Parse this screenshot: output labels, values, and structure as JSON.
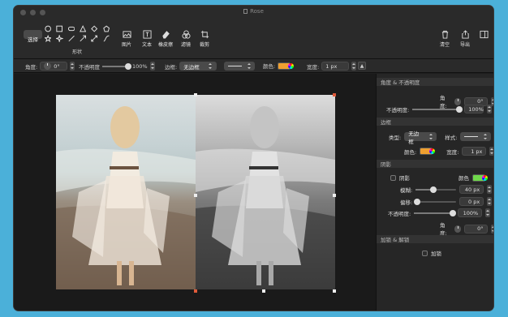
{
  "window": {
    "title": "Rose"
  },
  "toolbar": {
    "select_label": "选择",
    "shapes_label": "形状",
    "image_label": "图片",
    "text_label": "文本",
    "eraser_label": "橡皮擦",
    "filter_label": "滤镜",
    "crop_label": "裁剪",
    "clear_label": "清空",
    "export_label": "导出"
  },
  "options": {
    "angle_label": "角度:",
    "angle_value": "0°",
    "opacity_label": "不透明度",
    "opacity_value": "100%",
    "opacity_level": 1.0,
    "border_label": "边框:",
    "border_value": "无边框",
    "color_label": "颜色:",
    "color_hex": "#f0a030",
    "width_label": "宽度:",
    "width_value": "1 px"
  },
  "panel": {
    "angle_opacity_header": "角度 & 不透明度",
    "angle_label": "角度:",
    "angle_value": "0°",
    "opacity_label": "不透明度:",
    "opacity_value": "100%",
    "border_header": "边框",
    "type_label": "类型:",
    "type_value": "无边框",
    "style_label": "样式:",
    "color_label": "颜色:",
    "border_color_hex": "#f0a030",
    "width_label": "宽度:",
    "width_value": "1 px",
    "shadow_header": "阴影",
    "shadow_checkbox_label": "阴影",
    "shadow_color_label": "颜色",
    "shadow_color_hex": "#6fd84a",
    "blur_label": "模糊:",
    "blur_value": "40 px",
    "offset_label": "偏移:",
    "offset_value": "0 px",
    "shadow_opacity_label": "不透明度:",
    "shadow_opacity_value": "100%",
    "shadow_angle_label": "角度:",
    "shadow_angle_value": "0°",
    "lock_header": "加锁 & 解锁",
    "lock_checkbox_label": "加锁"
  }
}
